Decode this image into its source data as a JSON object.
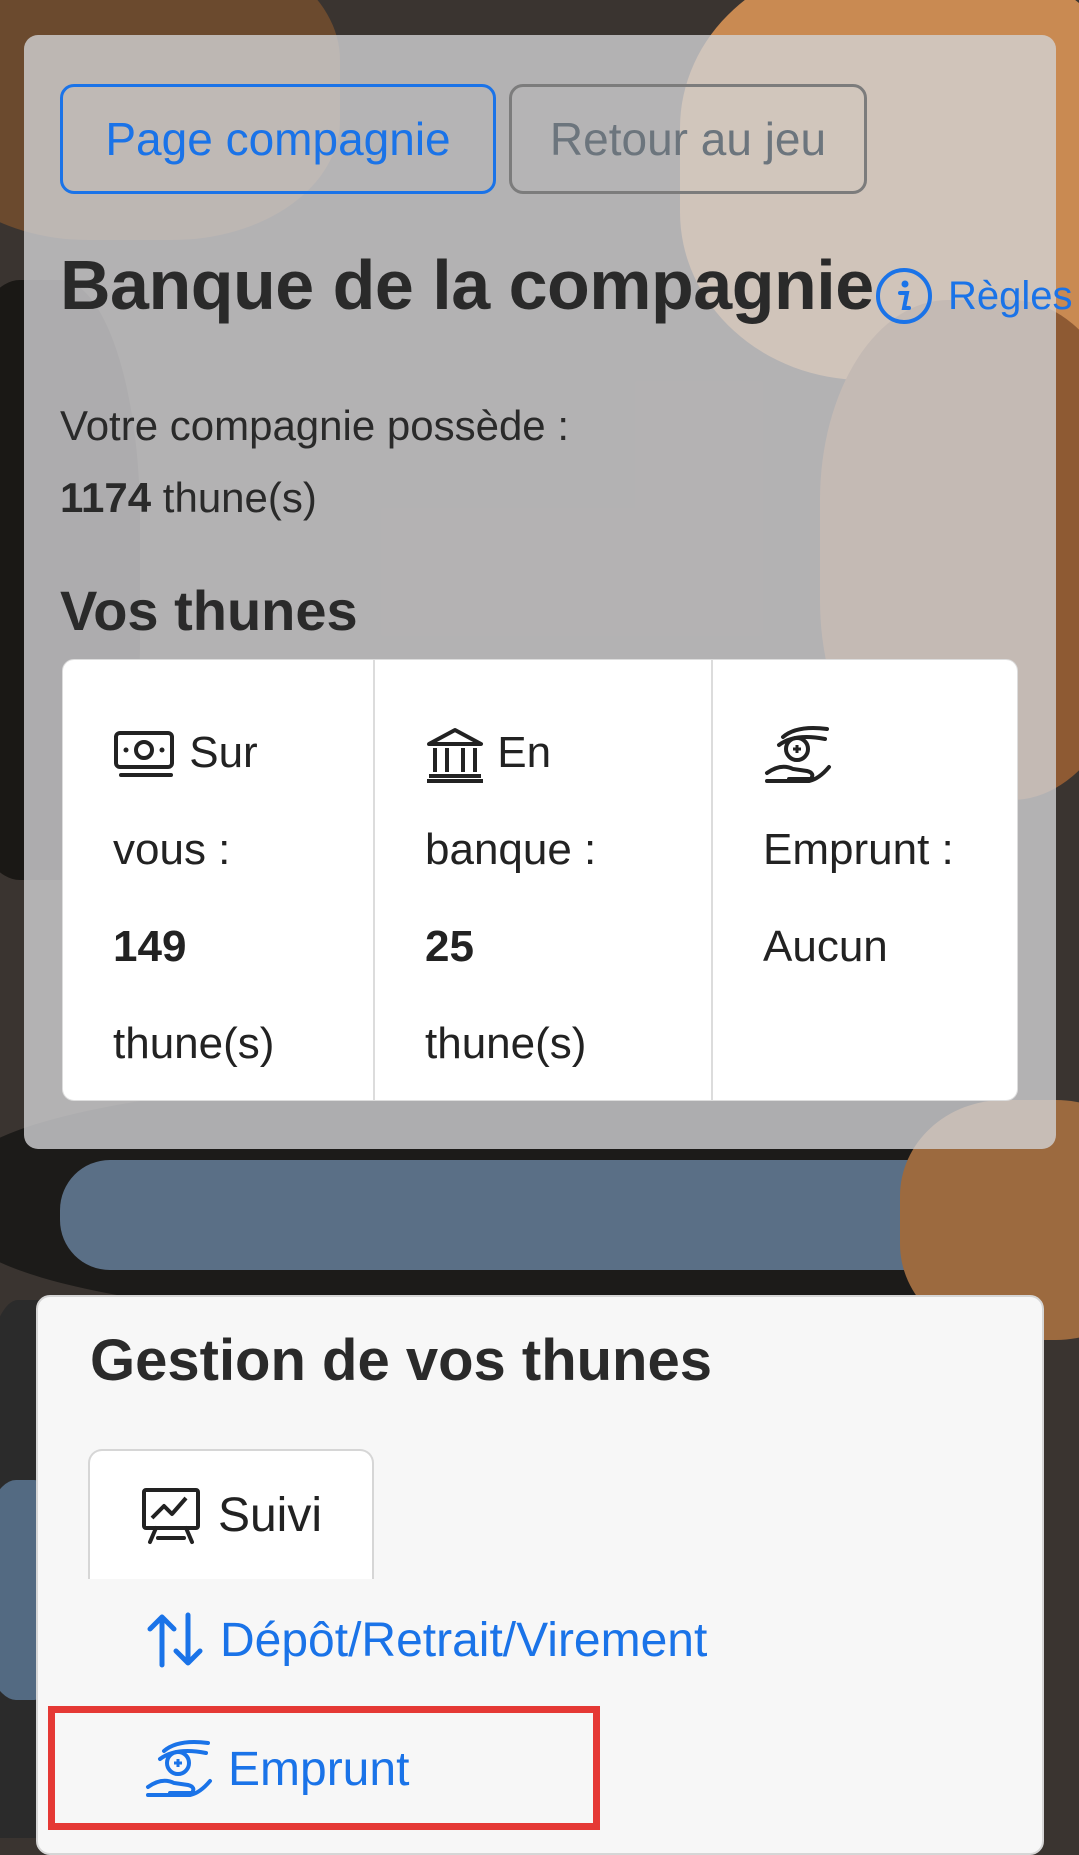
{
  "header_buttons": {
    "company_page": "Page compagnie",
    "back_to_game": "Retour au jeu"
  },
  "bank": {
    "title": "Banque de la compagnie",
    "rules_label": "Règles",
    "owns_label": "Votre compagnie possède :",
    "owns_amount": "1174",
    "owns_unit": "thune(s)"
  },
  "money": {
    "title": "Vos thunes",
    "on_you": {
      "label_line1": "Sur",
      "label_line2": "vous :",
      "amount": "149",
      "unit": "thune(s)",
      "icon": "cash-icon"
    },
    "in_bank": {
      "label_line1": "En",
      "label_line2": "banque :",
      "amount": "25",
      "unit": "thune(s)",
      "icon": "bank-icon"
    },
    "loan": {
      "label": "Emprunt :",
      "value": "Aucun",
      "icon": "loan-hand-icon"
    }
  },
  "management": {
    "title": "Gestion de vos thunes",
    "tabs": [
      {
        "label": "Suivi",
        "icon": "chart-presentation-icon",
        "active": true
      },
      {
        "label": "Dépôt/Retrait/Virement",
        "icon": "transfer-arrows-icon",
        "active": false
      },
      {
        "label": "Emprunt",
        "icon": "loan-hand-icon",
        "active": false
      }
    ]
  },
  "colors": {
    "accent": "#1a73e8",
    "secondary": "#6c757d",
    "highlight": "#e53935"
  }
}
